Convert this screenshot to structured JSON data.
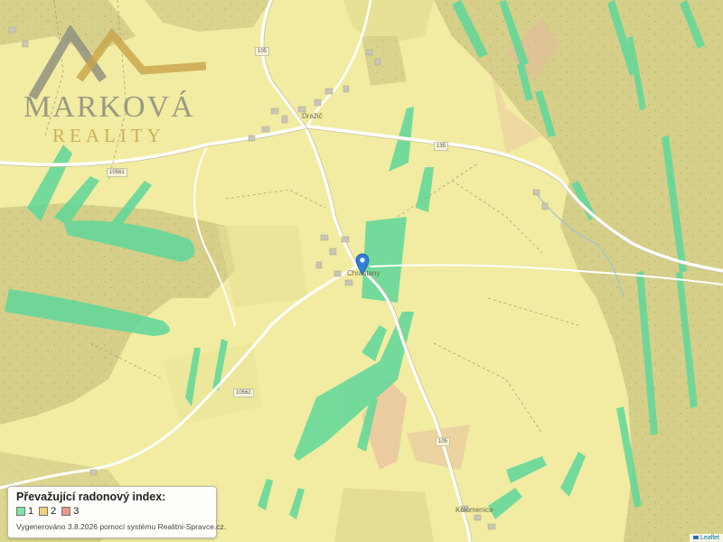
{
  "map": {
    "places": {
      "drazic": "Dražič",
      "chrastany": "Chrastany",
      "kolomenice": "Kolomenice"
    },
    "roads": [
      "105",
      "135",
      "10561",
      "10562",
      "105"
    ]
  },
  "logo": {
    "name": "MARKOVÁ",
    "subtitle": "REALITY"
  },
  "legend": {
    "title": "Převažující radonový index:",
    "items": [
      {
        "label": "1",
        "color": "#7fe3a6"
      },
      {
        "label": "2",
        "color": "#f2d27a"
      },
      {
        "label": "3",
        "color": "#e79a86"
      }
    ],
    "note": "Vygenerováno 3.8.2026 pomocí systému Realitni-Spravce.cz."
  },
  "attribution": "Leaflet",
  "colors": {
    "base": "#f1eca1",
    "forest": "#d6d08a",
    "green_zone": "#5fd89a",
    "red_zone": "#e7b7a0"
  }
}
